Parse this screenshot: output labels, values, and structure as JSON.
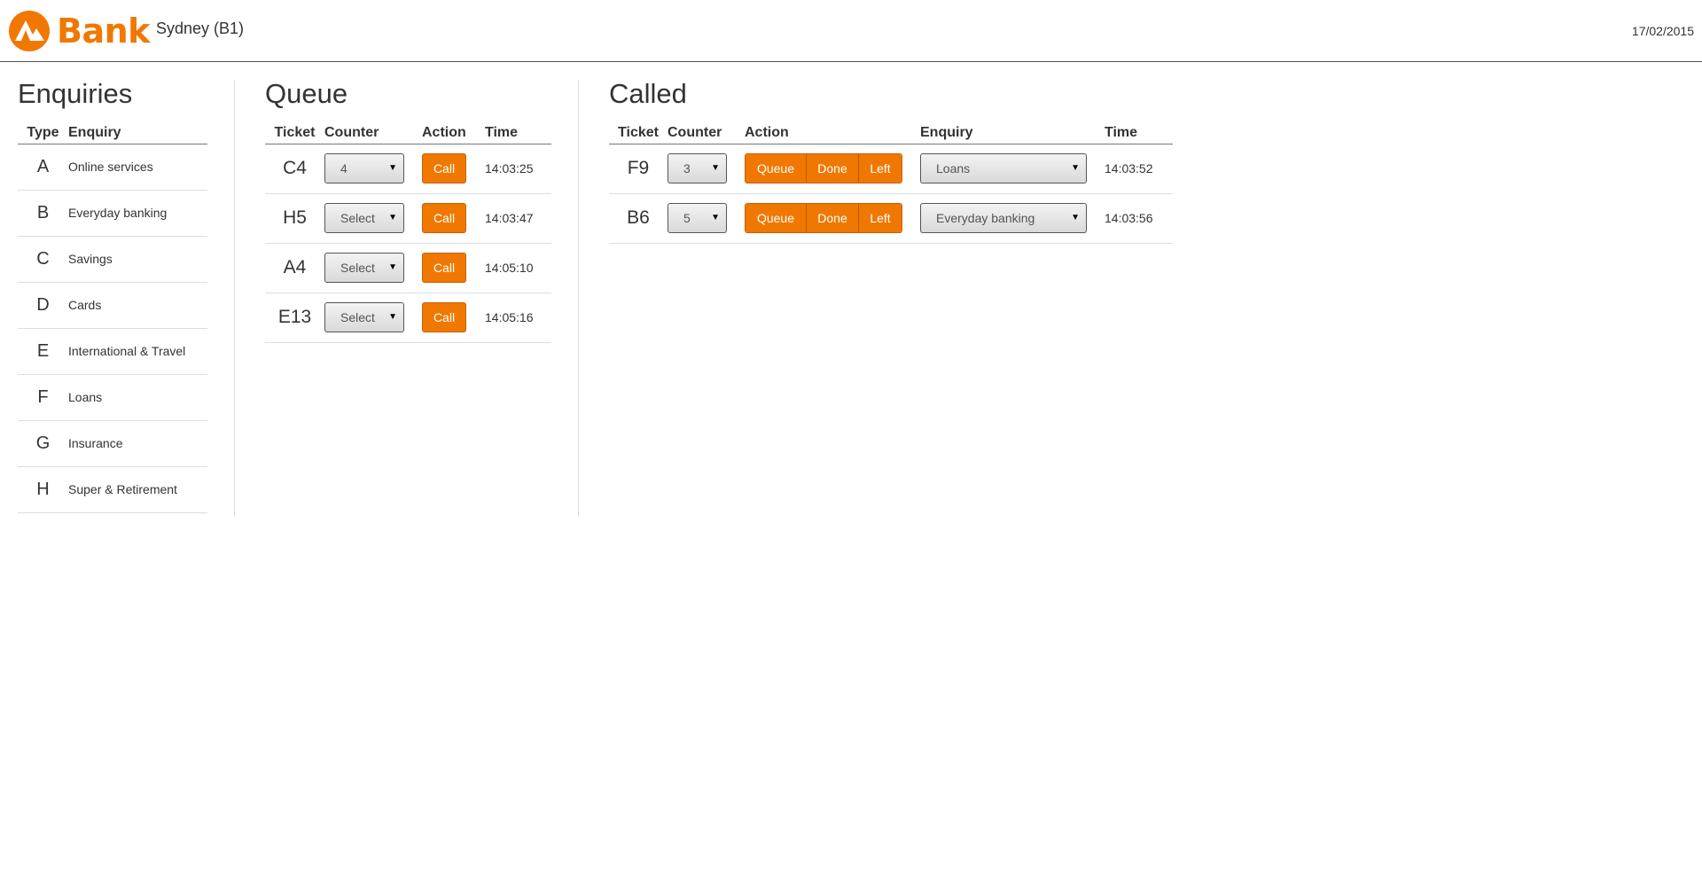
{
  "header": {
    "logo_text": "Bank",
    "branch": "Sydney (B1)",
    "date": "17/02/2015",
    "brand_color": "#f07800"
  },
  "enquiries": {
    "title": "Enquiries",
    "columns": [
      "Type",
      "Enquiry"
    ],
    "rows": [
      {
        "type": "A",
        "enquiry": "Online services"
      },
      {
        "type": "B",
        "enquiry": "Everyday banking"
      },
      {
        "type": "C",
        "enquiry": "Savings"
      },
      {
        "type": "D",
        "enquiry": "Cards"
      },
      {
        "type": "E",
        "enquiry": "International & Travel"
      },
      {
        "type": "F",
        "enquiry": "Loans"
      },
      {
        "type": "G",
        "enquiry": "Insurance"
      },
      {
        "type": "H",
        "enquiry": "Super & Retirement"
      }
    ]
  },
  "queue": {
    "title": "Queue",
    "columns": [
      "Ticket",
      "Counter",
      "Action",
      "Time"
    ],
    "call_label": "Call",
    "rows": [
      {
        "ticket": "C4",
        "counter": "4",
        "time": "14:03:25"
      },
      {
        "ticket": "H5",
        "counter": "Select",
        "time": "14:03:47"
      },
      {
        "ticket": "A4",
        "counter": "Select",
        "time": "14:05:10"
      },
      {
        "ticket": "E13",
        "counter": "Select",
        "time": "14:05:16"
      }
    ]
  },
  "called": {
    "title": "Called",
    "columns": [
      "Ticket",
      "Counter",
      "Action",
      "Enquiry",
      "Time"
    ],
    "actions": {
      "queue": "Queue",
      "done": "Done",
      "left": "Left"
    },
    "rows": [
      {
        "ticket": "F9",
        "counter": "3",
        "enquiry": "Loans",
        "time": "14:03:52"
      },
      {
        "ticket": "B6",
        "counter": "5",
        "enquiry": "Everyday banking",
        "time": "14:03:56"
      }
    ]
  },
  "icons": {
    "logo": "bank-logo-icon",
    "dropdown": "chevron-down-icon"
  }
}
